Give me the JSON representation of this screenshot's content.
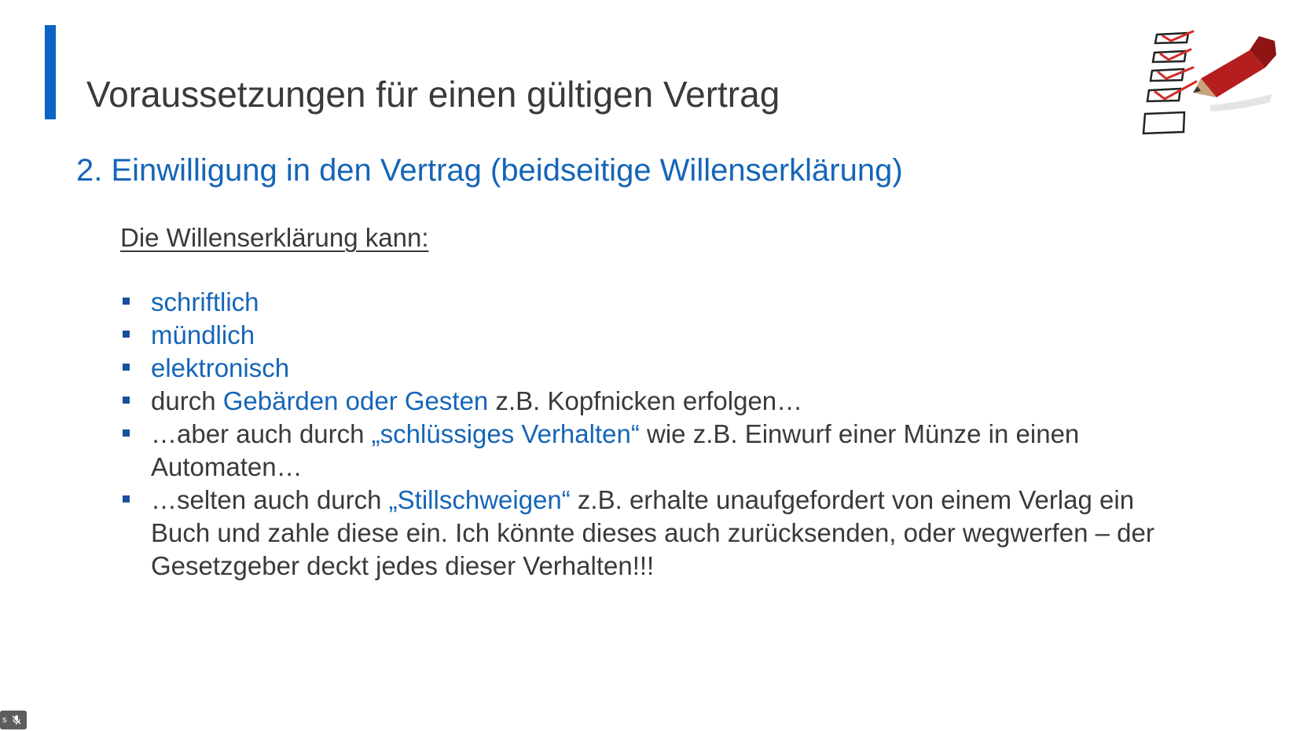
{
  "slide": {
    "title": "Voraussetzungen für einen gültigen Vertrag",
    "subtitle": "2. Einwilligung in den Vertrag (beidseitige Willenserklärung)",
    "intro": "Die Willenserklärung kann:",
    "bullets": [
      {
        "plain": "",
        "highlight": "schriftlich",
        "rest": ""
      },
      {
        "plain": "",
        "highlight": "mündlich",
        "rest": ""
      },
      {
        "plain": "",
        "highlight": "elektronisch",
        "rest": ""
      },
      {
        "plain": "durch ",
        "highlight": "Gebärden oder Gesten",
        "rest": " z.B. Kopfnicken erfolgen…"
      },
      {
        "plain": "…aber auch durch ",
        "highlight": "„schlüssiges Verhalten“",
        "rest": " wie z.B. Einwurf einer Münze in einen Automaten…"
      },
      {
        "plain": "…selten auch durch ",
        "highlight": "„Stillschweigen“",
        "rest": " z.B. erhalte unaufgefordert von einem Verlag ein Buch und zahle diese ein. Ich könnte dieses auch zurücksenden, oder wegwerfen – der Gesetzgeber deckt jedes dieser Verhalten!!!"
      }
    ]
  },
  "status_bar": {
    "label": "s",
    "mic_icon": "mic-muted-icon"
  },
  "colors": {
    "accent": "#0b63c6",
    "highlight_text": "#1565b8",
    "body_text": "#3a3a3a",
    "bullet_marker": "#1a4f9c"
  }
}
